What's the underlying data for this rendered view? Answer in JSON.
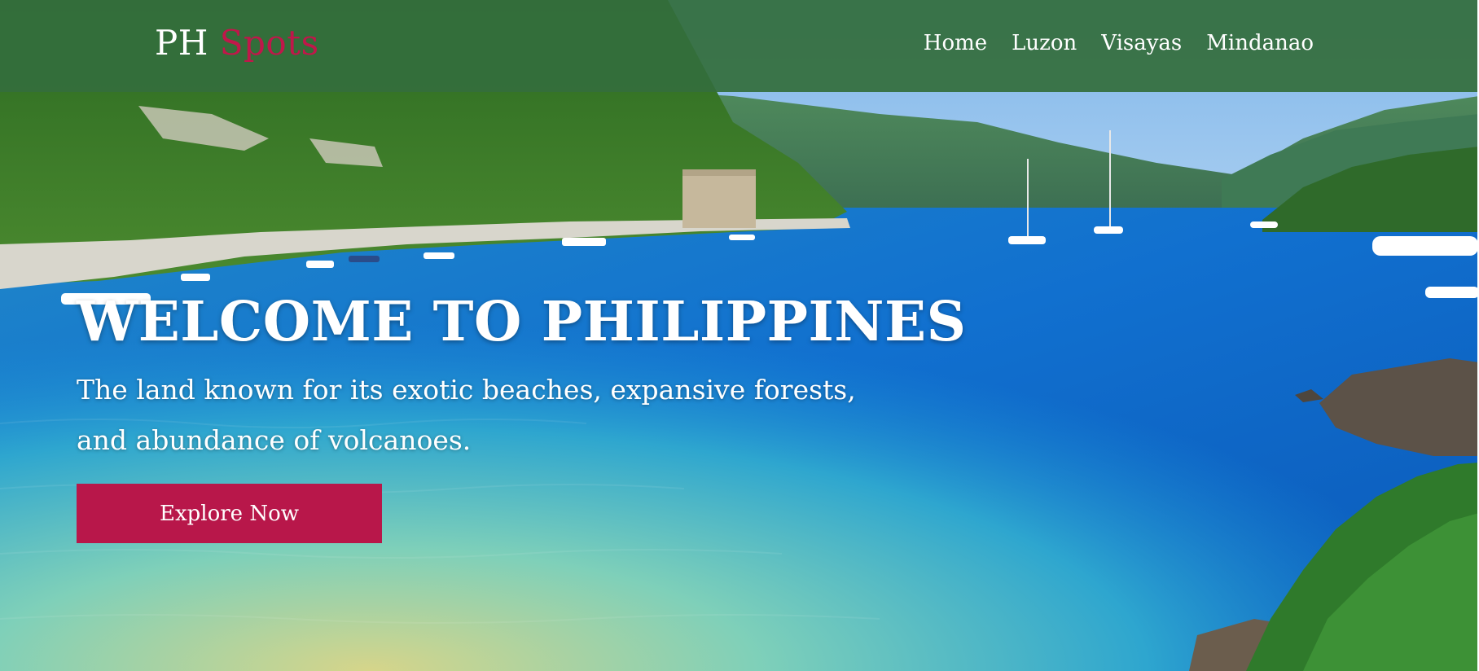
{
  "brand": {
    "name_primary": "PH",
    "name_accent": "Spots",
    "accent_color": "#c0174a"
  },
  "nav": {
    "links": [
      {
        "label": "Home"
      },
      {
        "label": "Luzon"
      },
      {
        "label": "Visayas"
      },
      {
        "label": "Mindanao"
      }
    ],
    "background_color": "#346e3c"
  },
  "hero": {
    "title": "WELCOME TO PHILIPPINES",
    "subtitle": "The land known for its exotic beaches, expansive forests, and abundance of volcanoes.",
    "cta_label": "Explore Now",
    "cta_color": "#b8174a",
    "background_image": "tropical-bay-photo"
  }
}
